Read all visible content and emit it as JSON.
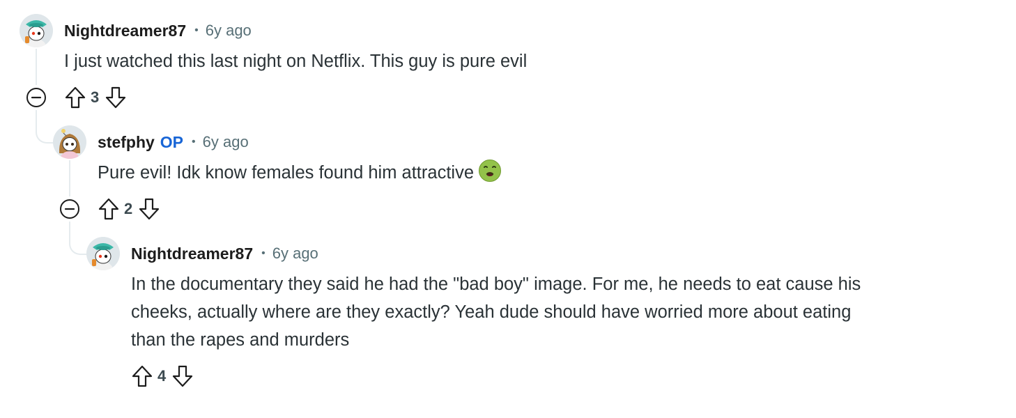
{
  "comments": [
    {
      "author": "Nightdreamer87",
      "time": "6y ago",
      "body": [
        "I just watched this last night on Netflix. This guy is pure evil"
      ],
      "score": "3",
      "avatar_icon": "snoo-avatar-teal-hat-icon"
    },
    {
      "author": "stefphy",
      "badge": "OP",
      "time": "6y ago",
      "body": [
        "Pure evil! Idk know females found him attractive"
      ],
      "emoji": "nauseated-face-emoji",
      "score": "2",
      "avatar_icon": "snoo-avatar-brown-hair-icon"
    },
    {
      "author": "Nightdreamer87",
      "time": "6y ago",
      "body": [
        "In the documentary they said he had the \"bad boy\" image. For me, he needs to eat cause his",
        "cheeks, actually where are they exactly? Yeah dude should have worried more about eating",
        "than the rapes and murders"
      ],
      "score": "4",
      "avatar_icon": "snoo-avatar-teal-hat-icon"
    }
  ],
  "icons": {
    "upvote": "upvote-arrow-icon",
    "downvote": "downvote-arrow-icon",
    "collapse": "collapse-minus-icon",
    "separator": "•"
  },
  "colors": {
    "meta_text": "#576f76",
    "op_badge": "#1865d6",
    "thread_line": "#e5ebee",
    "body_text": "#2a3236"
  }
}
